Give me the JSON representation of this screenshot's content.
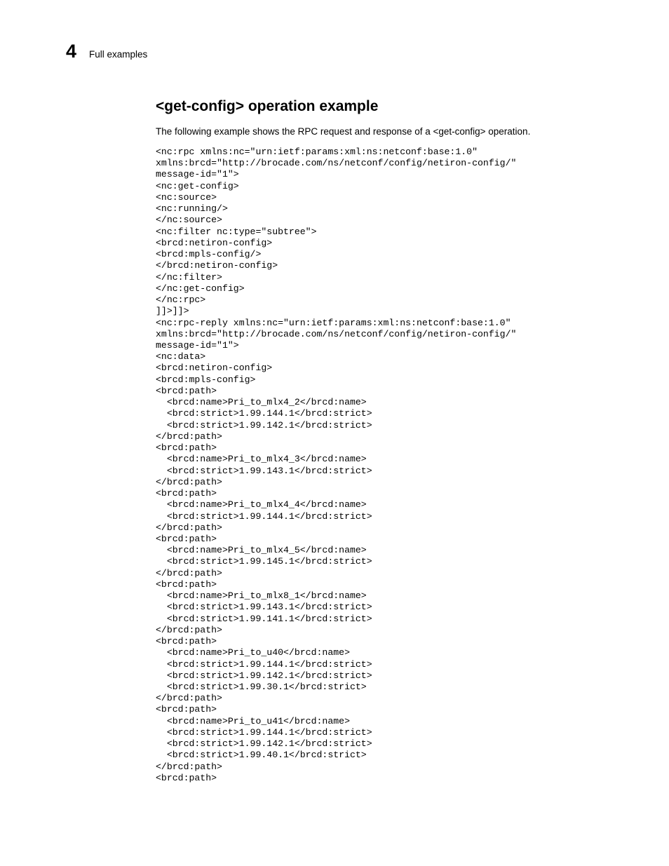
{
  "pageNumber": "4",
  "headerText": "Full examples",
  "heading": "<get-config> operation example",
  "intro": "The following example shows the RPC request and response of a <get-config> operation.",
  "code": "<nc:rpc xmlns:nc=\"urn:ietf:params:xml:ns:netconf:base:1.0\"\nxmlns:brcd=\"http://brocade.com/ns/netconf/config/netiron-config/\"\nmessage-id=\"1\">\n<nc:get-config>\n<nc:source>\n<nc:running/>\n</nc:source>\n<nc:filter nc:type=\"subtree\">\n<brcd:netiron-config>\n<brcd:mpls-config/>\n</brcd:netiron-config>\n</nc:filter>\n</nc:get-config>\n</nc:rpc>\n]]>]]>\n<nc:rpc-reply xmlns:nc=\"urn:ietf:params:xml:ns:netconf:base:1.0\"\nxmlns:brcd=\"http://brocade.com/ns/netconf/config/netiron-config/\"\nmessage-id=\"1\">\n<nc:data>\n<brcd:netiron-config>\n<brcd:mpls-config>\n<brcd:path>\n  <brcd:name>Pri_to_mlx4_2</brcd:name>\n  <brcd:strict>1.99.144.1</brcd:strict>\n  <brcd:strict>1.99.142.1</brcd:strict>\n</brcd:path>\n<brcd:path>\n  <brcd:name>Pri_to_mlx4_3</brcd:name>\n  <brcd:strict>1.99.143.1</brcd:strict>\n</brcd:path>\n<brcd:path>\n  <brcd:name>Pri_to_mlx4_4</brcd:name>\n  <brcd:strict>1.99.144.1</brcd:strict>\n</brcd:path>\n<brcd:path>\n  <brcd:name>Pri_to_mlx4_5</brcd:name>\n  <brcd:strict>1.99.145.1</brcd:strict>\n</brcd:path>\n<brcd:path>\n  <brcd:name>Pri_to_mlx8_1</brcd:name>\n  <brcd:strict>1.99.143.1</brcd:strict>\n  <brcd:strict>1.99.141.1</brcd:strict>\n</brcd:path>\n<brcd:path>\n  <brcd:name>Pri_to_u40</brcd:name>\n  <brcd:strict>1.99.144.1</brcd:strict>\n  <brcd:strict>1.99.142.1</brcd:strict>\n  <brcd:strict>1.99.30.1</brcd:strict>\n</brcd:path>\n<brcd:path>\n  <brcd:name>Pri_to_u41</brcd:name>\n  <brcd:strict>1.99.144.1</brcd:strict>\n  <brcd:strict>1.99.142.1</brcd:strict>\n  <brcd:strict>1.99.40.1</brcd:strict>\n</brcd:path>\n<brcd:path>"
}
